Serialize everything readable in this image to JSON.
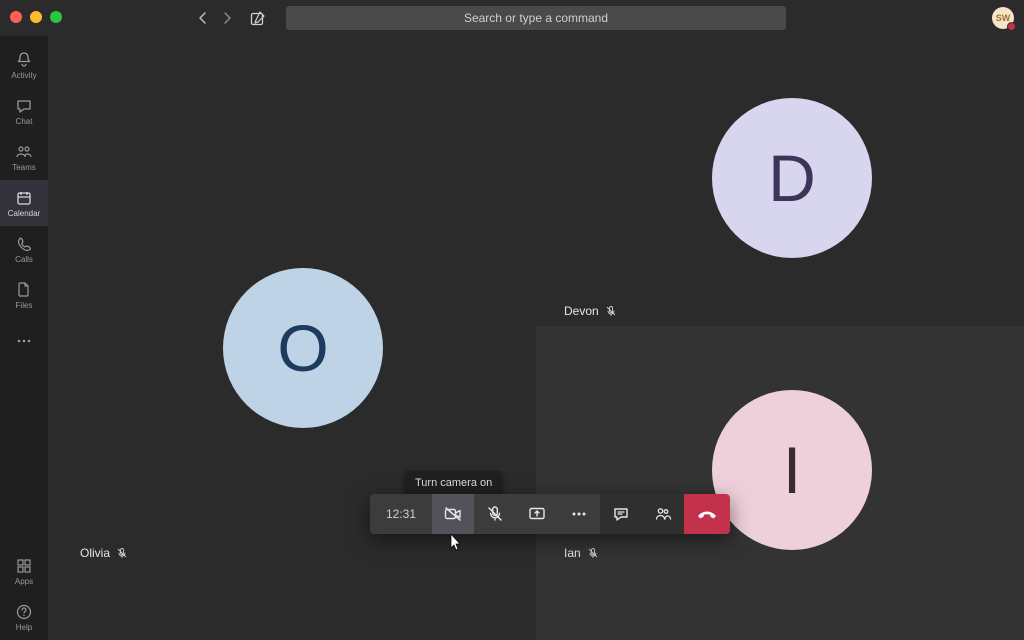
{
  "search": {
    "placeholder": "Search or type a command"
  },
  "user": {
    "initials": "SW"
  },
  "rail": {
    "activity": "Activity",
    "chat": "Chat",
    "teams": "Teams",
    "calendar": "Calendar",
    "calls": "Calls",
    "files": "Files",
    "apps": "Apps",
    "help": "Help"
  },
  "participants": {
    "olivia": {
      "initial": "O",
      "name": "Olivia"
    },
    "devon": {
      "initial": "D",
      "name": "Devon"
    },
    "ian": {
      "initial": "I",
      "name": "Ian"
    }
  },
  "tooltip": {
    "camera": "Turn camera on"
  },
  "controls": {
    "time": "12:31"
  }
}
